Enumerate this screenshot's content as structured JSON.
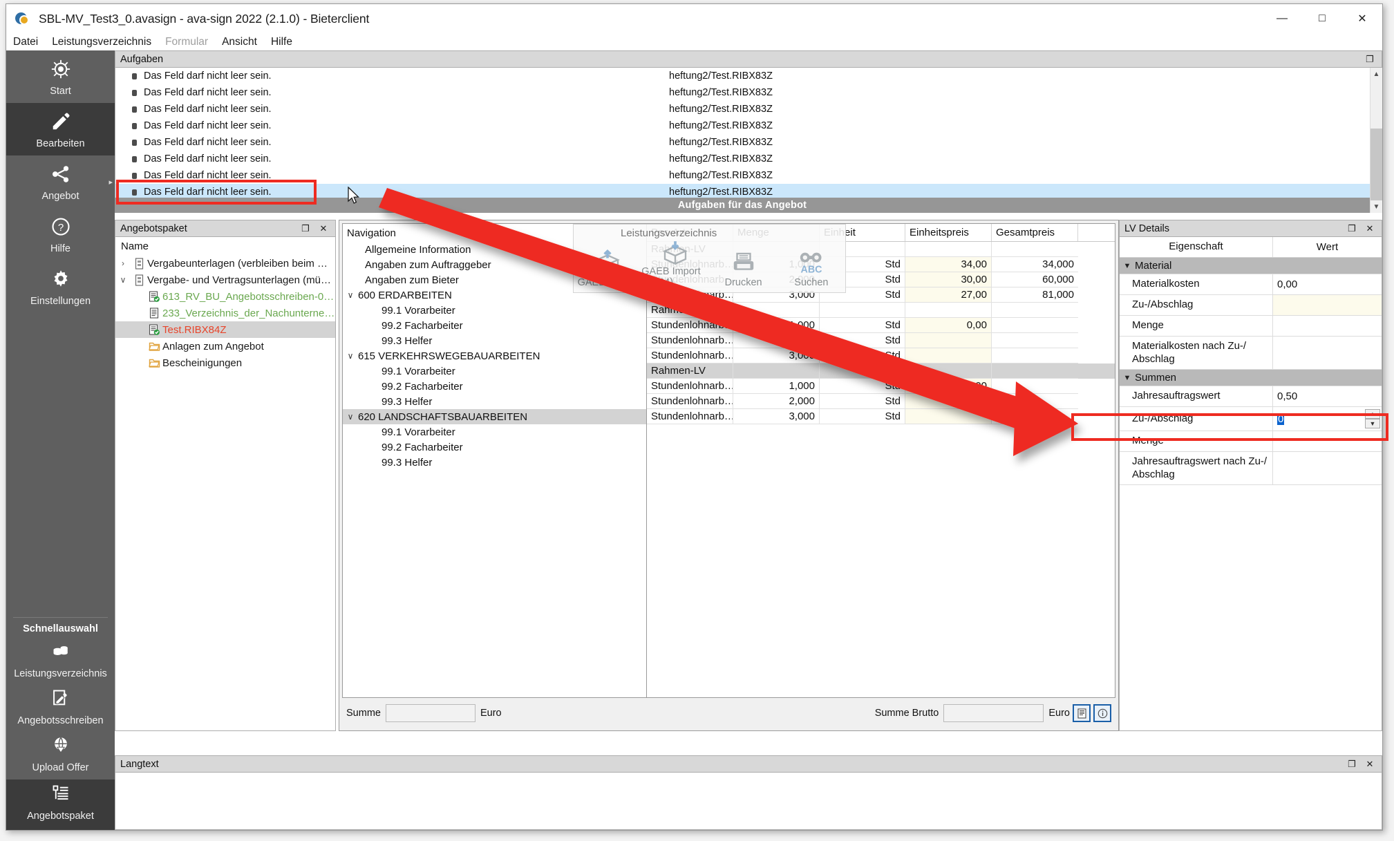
{
  "window": {
    "title": "SBL-MV_Test3_0.avasign - ava-sign 2022 (2.1.0) - Bieterclient",
    "minimize": "—",
    "maximize": "□",
    "close": "✕"
  },
  "menu": [
    {
      "label": "Datei",
      "disabled": false
    },
    {
      "label": "Leistungsverzeichnis",
      "disabled": false
    },
    {
      "label": "Formular",
      "disabled": true
    },
    {
      "label": "Ansicht",
      "disabled": false
    },
    {
      "label": "Hilfe",
      "disabled": false
    }
  ],
  "rail": {
    "items": [
      {
        "label": "Start",
        "icon": "ship-wheel-icon",
        "active": false,
        "arrow": false
      },
      {
        "label": "Bearbeiten",
        "icon": "pencil-icon",
        "active": true,
        "arrow": false
      },
      {
        "label": "Angebot",
        "icon": "share-icon",
        "active": false,
        "arrow": true
      },
      {
        "label": "Hilfe",
        "icon": "question-circle-icon",
        "active": false,
        "arrow": false
      },
      {
        "label": "Einstellungen",
        "icon": "gear-icon",
        "active": false,
        "arrow": false
      }
    ],
    "quick_header": "Schnellauswahl",
    "quick_items": [
      {
        "label": "Leistungsverzeichnis",
        "icon": "coins-icon",
        "active": false
      },
      {
        "label": "Angebotsschreiben",
        "icon": "document-pencil-icon",
        "active": false
      },
      {
        "label": "Upload Offer",
        "icon": "globe-upload-icon",
        "active": false
      },
      {
        "label": "Angebotspaket",
        "icon": "list-tree-icon",
        "active": true
      }
    ]
  },
  "aufgaben": {
    "title": "Aufgaben",
    "footer": "Aufgaben für das Angebot",
    "rows": [
      {
        "message": "Das Feld darf nicht leer sein.",
        "source": "heftung2/Test.RIBX83Z",
        "selected": false
      },
      {
        "message": "Das Feld darf nicht leer sein.",
        "source": "heftung2/Test.RIBX83Z",
        "selected": false
      },
      {
        "message": "Das Feld darf nicht leer sein.",
        "source": "heftung2/Test.RIBX83Z",
        "selected": false
      },
      {
        "message": "Das Feld darf nicht leer sein.",
        "source": "heftung2/Test.RIBX83Z",
        "selected": false
      },
      {
        "message": "Das Feld darf nicht leer sein.",
        "source": "heftung2/Test.RIBX83Z",
        "selected": false
      },
      {
        "message": "Das Feld darf nicht leer sein.",
        "source": "heftung2/Test.RIBX83Z",
        "selected": false
      },
      {
        "message": "Das Feld darf nicht leer sein.",
        "source": "heftung2/Test.RIBX83Z",
        "selected": false
      },
      {
        "message": "Das Feld darf nicht leer sein.",
        "source": "heftung2/Test.RIBX83Z",
        "selected": true
      }
    ]
  },
  "angebotspaket": {
    "title": "Angebotspaket",
    "column_header": "Name",
    "tree": [
      {
        "label": "Vergabeunterlagen (verbleiben beim …",
        "chevron": "›",
        "icon": "binder-icon",
        "indent": 0,
        "color": "",
        "selected": false
      },
      {
        "label": "Vergabe- und Vertragsunterlagen (mü…",
        "chevron": "∨",
        "icon": "binder-icon",
        "indent": 0,
        "color": "",
        "selected": false
      },
      {
        "label": "613_RV_BU_Angebotsschreiben-0…",
        "chevron": "",
        "icon": "doc-check-icon",
        "indent": 1,
        "color": "green",
        "selected": false
      },
      {
        "label": "233_Verzeichnis_der_Nachunterne…",
        "chevron": "",
        "icon": "doc-icon",
        "indent": 1,
        "color": "green",
        "selected": false
      },
      {
        "label": "Test.RIBX84Z",
        "chevron": "",
        "icon": "doc-check-icon",
        "indent": 1,
        "color": "red",
        "selected": true
      },
      {
        "label": "Anlagen zum Angebot",
        "chevron": "",
        "icon": "folder-icon",
        "indent": 1,
        "color": "",
        "selected": false
      },
      {
        "label": "Bescheinigungen",
        "chevron": "",
        "icon": "folder-icon",
        "indent": 1,
        "color": "",
        "selected": false
      }
    ]
  },
  "navigation": {
    "header": "Navigation",
    "rows": [
      {
        "label": "Allgemeine Information",
        "chevron": "",
        "indent": 1,
        "selected": false
      },
      {
        "label": "Angaben zum Auftraggeber",
        "chevron": "",
        "indent": 1,
        "selected": false
      },
      {
        "label": "Angaben zum Bieter",
        "chevron": "",
        "indent": 1,
        "selected": false
      },
      {
        "label": "600 ERDARBEITEN",
        "chevron": "∨",
        "indent": 0,
        "selected": false
      },
      {
        "label": "99.1 Vorarbeiter",
        "chevron": "",
        "indent": 2,
        "selected": false
      },
      {
        "label": "99.2 Facharbeiter",
        "chevron": "",
        "indent": 2,
        "selected": false
      },
      {
        "label": "99.3 Helfer",
        "chevron": "",
        "indent": 2,
        "selected": false
      },
      {
        "label": "615 VERKEHRSWEGEBAUARBEITEN",
        "chevron": "∨",
        "indent": 0,
        "selected": false
      },
      {
        "label": "99.1 Vorarbeiter",
        "chevron": "",
        "indent": 2,
        "selected": false
      },
      {
        "label": "99.2 Facharbeiter",
        "chevron": "",
        "indent": 2,
        "selected": false
      },
      {
        "label": "99.3 Helfer",
        "chevron": "",
        "indent": 2,
        "selected": false
      },
      {
        "label": "620 LANDSCHAFTSBAUARBEITEN",
        "chevron": "∨",
        "indent": 0,
        "selected": true
      },
      {
        "label": "99.1 Vorarbeiter",
        "chevron": "",
        "indent": 2,
        "selected": false
      },
      {
        "label": "99.2 Facharbeiter",
        "chevron": "",
        "indent": 2,
        "selected": false
      },
      {
        "label": "99.3 Helfer",
        "chevron": "",
        "indent": 2,
        "selected": false
      }
    ]
  },
  "lv_table": {
    "columns": [
      "Pos-Art",
      "Menge",
      "Einheit",
      "Einheitspreis",
      "Gesamtpreis"
    ],
    "rows": [
      {
        "posart": "Rahmen-LV",
        "menge": "",
        "einheit": "",
        "einheitspreis": "",
        "gesamtpreis": "",
        "selected": false
      },
      {
        "posart": "Stundenlohnarb…",
        "menge": "1,000",
        "einheit": "Std",
        "einheitspreis": "34,00",
        "gesamtpreis": "34,000",
        "selected": false
      },
      {
        "posart": "Stundenlohnarb…",
        "menge": "2,000",
        "einheit": "Std",
        "einheitspreis": "30,00",
        "gesamtpreis": "60,000",
        "selected": false
      },
      {
        "posart": "Stundenlohnarb…",
        "menge": "3,000",
        "einheit": "Std",
        "einheitspreis": "27,00",
        "gesamtpreis": "81,000",
        "selected": false
      },
      {
        "posart": "Rahmen-LV",
        "menge": "",
        "einheit": "",
        "einheitspreis": "",
        "gesamtpreis": "",
        "selected": false
      },
      {
        "posart": "Stundenlohnarb…",
        "menge": "1,000",
        "einheit": "Std",
        "einheitspreis": "0,00",
        "gesamtpreis": "",
        "selected": false
      },
      {
        "posart": "Stundenlohnarb…",
        "menge": "2,000",
        "einheit": "Std",
        "einheitspreis": "",
        "gesamtpreis": "",
        "selected": false
      },
      {
        "posart": "Stundenlohnarb…",
        "menge": "3,000",
        "einheit": "Std",
        "einheitspreis": "",
        "gesamtpreis": "",
        "selected": false
      },
      {
        "posart": "Rahmen-LV",
        "menge": "",
        "einheit": "",
        "einheitspreis": "",
        "gesamtpreis": "",
        "selected": true
      },
      {
        "posart": "Stundenlohnarb…",
        "menge": "1,000",
        "einheit": "Std",
        "einheitspreis": "0,00",
        "gesamtpreis": "",
        "selected": false
      },
      {
        "posart": "Stundenlohnarb…",
        "menge": "2,000",
        "einheit": "Std",
        "einheitspreis": "",
        "gesamtpreis": "",
        "selected": false
      },
      {
        "posart": "Stundenlohnarb…",
        "menge": "3,000",
        "einheit": "Std",
        "einheitspreis": "",
        "gesamtpreis": "",
        "selected": false
      }
    ]
  },
  "floating_toolbar": {
    "group_label": "Leistungsverzeichnis",
    "buttons": [
      {
        "label": "GAEB-Export",
        "icon": "box-up-arrow-icon"
      },
      {
        "label": "GAEB Import (DA84)",
        "icon": "box-down-arrow-icon"
      },
      {
        "label": "Drucken",
        "icon": "printer-icon"
      },
      {
        "label": "Suchen",
        "icon": "binoculars-abc-icon"
      }
    ]
  },
  "summary_bar": {
    "summe_label": "Summe",
    "summe_value": "",
    "summe_currency": "Euro",
    "brutto_label": "Summe Brutto",
    "brutto_value": "",
    "brutto_currency": "Euro",
    "buttons": [
      {
        "icon": "report-icon"
      },
      {
        "icon": "info-icon"
      }
    ]
  },
  "lv_details": {
    "title": "LV Details",
    "columns": [
      "Eigenschaft",
      "Wert"
    ],
    "rows": [
      {
        "kind": "group",
        "property": "Material",
        "value": "",
        "highlight": false,
        "editing": false
      },
      {
        "kind": "item",
        "property": "Materialkosten",
        "value": "0,00",
        "highlight": false,
        "editing": false
      },
      {
        "kind": "item",
        "property": "Zu-/Abschlag",
        "value": "",
        "highlight": true,
        "editing": false
      },
      {
        "kind": "item",
        "property": "Menge",
        "value": "",
        "highlight": false,
        "editing": false
      },
      {
        "kind": "item",
        "property": "Materialkosten nach Zu-/ Abschlag",
        "value": "",
        "highlight": false,
        "editing": false
      },
      {
        "kind": "group",
        "property": "Summen",
        "value": "",
        "highlight": false,
        "editing": false
      },
      {
        "kind": "item",
        "property": "Jahresauftragswert",
        "value": "0,50",
        "highlight": false,
        "editing": false
      },
      {
        "kind": "item",
        "property": "Zu-/Abschlag",
        "value": "0",
        "highlight": false,
        "editing": true
      },
      {
        "kind": "item",
        "property": "Menge",
        "value": "",
        "highlight": false,
        "editing": false
      },
      {
        "kind": "item",
        "property": "Jahresauftragswert nach Zu-/ Abschlag",
        "value": "",
        "highlight": false,
        "editing": false
      }
    ]
  },
  "langtext": {
    "title": "Langtext",
    "content": ""
  },
  "panel_buttons": {
    "float": "❐",
    "close": "✕"
  },
  "annotation": {
    "color": "#ee2b21"
  }
}
